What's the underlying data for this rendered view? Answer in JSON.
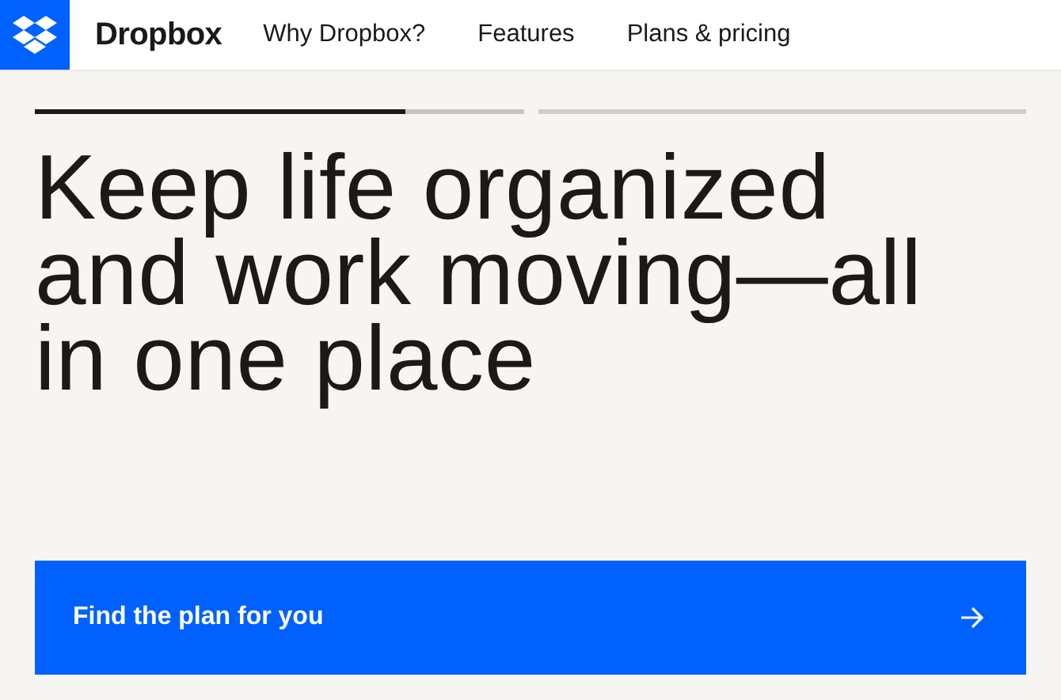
{
  "header": {
    "brand": "Dropbox",
    "nav": [
      "Why Dropbox?",
      "Features",
      "Plans & pricing"
    ]
  },
  "carousel_progress": [
    {
      "selected": true,
      "level": 0.76
    },
    {
      "selected": false
    }
  ],
  "headline": "Keep life organized and work moving—all in one place",
  "cta": {
    "label": "Find the plan for you"
  }
}
